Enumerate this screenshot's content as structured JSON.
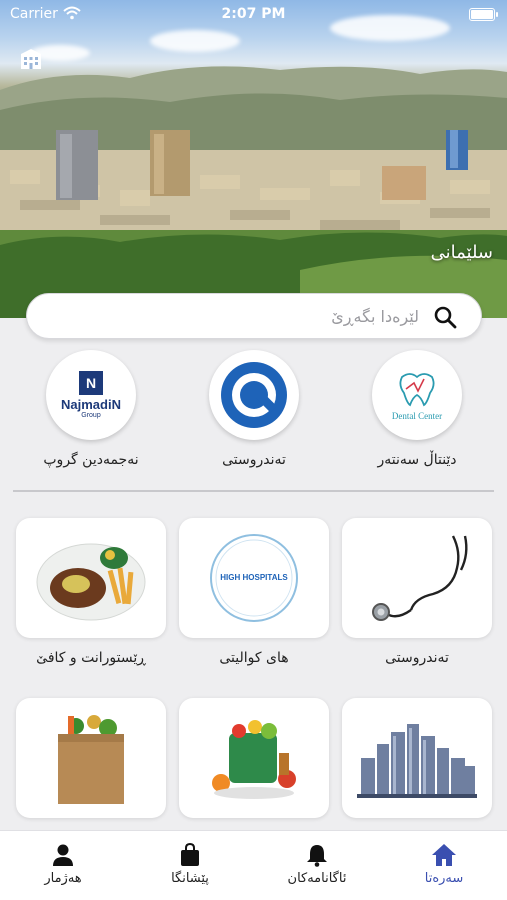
{
  "status_bar": {
    "carrier": "Carrier",
    "time": "2:07 PM"
  },
  "hero": {
    "city_name": "سلێمانی"
  },
  "search": {
    "placeholder": "لێرەدا بگەڕێ",
    "value": ""
  },
  "featured": [
    {
      "label": "نەجمەدین گروپ",
      "logo_text": "NajmadiN",
      "logo_sub": "Group",
      "logo_mark": "N"
    },
    {
      "label": "تەندروستی",
      "logo_text": "Q"
    },
    {
      "label": "دێنتاڵ سەنتەر",
      "logo_text": "Dental Center"
    }
  ],
  "categories": [
    {
      "label": "ڕێستورانت و کافێ",
      "icon": "food-plate-icon"
    },
    {
      "label": "های کوالیتی",
      "icon": "hospital-logo-icon",
      "logo_text": "HIGH HOSPITALS"
    },
    {
      "label": "تەندروستی",
      "icon": "stethoscope-icon"
    },
    {
      "label": "",
      "icon": "grocery-bag-icon"
    },
    {
      "label": "",
      "icon": "grocery-basket-icon"
    },
    {
      "label": "",
      "icon": "city-buildings-icon"
    }
  ],
  "tabbar": [
    {
      "label": "هەژمار",
      "icon": "person-icon"
    },
    {
      "label": "پێشانگا",
      "icon": "shopping-bag-icon"
    },
    {
      "label": "ئاگانامەکان",
      "icon": "bell-icon"
    },
    {
      "label": "سەرەتا",
      "icon": "home-icon"
    }
  ],
  "colors": {
    "accent": "#3a4fb0",
    "background": "#eeeef0"
  }
}
